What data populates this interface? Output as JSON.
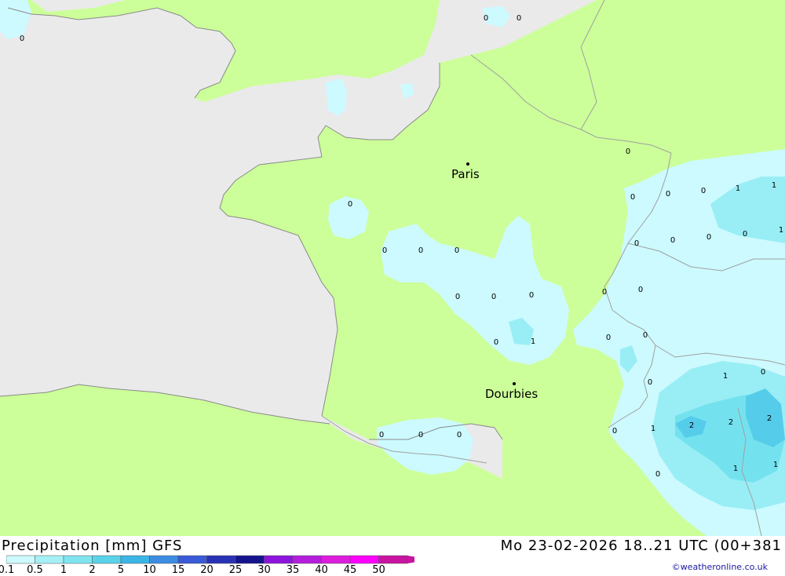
{
  "map": {
    "cities": [
      {
        "name": "Paris"
      },
      {
        "name": "Dourbies"
      }
    ],
    "value_labels": [
      "0",
      "0",
      "0",
      "0",
      "0",
      "0",
      "0",
      "0",
      "0",
      "0",
      "0",
      "1",
      "1",
      "0",
      "0",
      "1",
      "0",
      "0",
      "0",
      "0",
      "0",
      "0",
      "0",
      "1",
      "0",
      "0",
      "0",
      "0",
      "1",
      "0",
      "0",
      "2",
      "2",
      "2",
      "0",
      "1",
      "1",
      "1",
      "0",
      "0",
      "0"
    ],
    "colors": {
      "sea": "#eaeaea",
      "land": "#ccff99",
      "border": "#a0a0a0",
      "precip_0_1": "#ccfaff",
      "precip_0_5": "#99eef5",
      "precip_1": "#74e2ee",
      "precip_2": "#55ccea"
    }
  },
  "footer": {
    "title": "Precipitation [mm] GFS",
    "valid_time": "Mo 23-02-2026 18..21 UTC (00+381",
    "credit": "©weatheronline.co.uk"
  },
  "legend": {
    "ticks": [
      "0.1",
      "0.5",
      "1",
      "2",
      "5",
      "10",
      "15",
      "20",
      "25",
      "30",
      "35",
      "40",
      "45",
      "50"
    ],
    "colors": [
      "#ccfaff",
      "#a5f0f6",
      "#80e4ef",
      "#5ad2ea",
      "#3cb4e6",
      "#3c8ce1",
      "#3a5ad7",
      "#2832b4",
      "#14148c",
      "#8c14dc",
      "#b41edc",
      "#dc1edc",
      "#ff00ff",
      "#c814a0"
    ]
  }
}
